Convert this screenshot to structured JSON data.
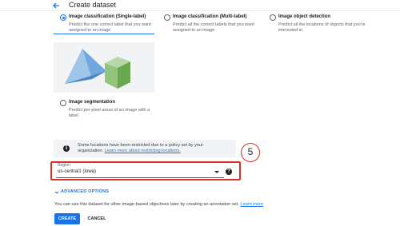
{
  "header": {
    "title": "Create dataset"
  },
  "options": [
    {
      "label": "Image classification (Single-label)",
      "desc": "Predict the one correct label that you want assigned to an image",
      "checked": true
    },
    {
      "label": "Image classification (Multi-label)",
      "desc": "Predict all the correct labels that you want assigned to an image",
      "checked": false
    },
    {
      "label": "Image object detection",
      "desc": "Predict all the locations of objects that you're interested in.",
      "checked": false
    },
    {
      "label": "Image segmentation",
      "desc": "Predict per-pixel areas of an image with a label.",
      "checked": false
    }
  ],
  "notice": {
    "text": "Some locations have been restricted due to a policy set by your organization.",
    "link": "Learn more about restricting locations."
  },
  "annotation_number": "5",
  "region": {
    "label": "Region",
    "value": "us-central1 (Iowa)"
  },
  "advanced_options": "ADVANCED OPTIONS",
  "footnote": {
    "text": "You can use this dataset for other image-based objectives later by creating an annotation set.",
    "link": "Learn more"
  },
  "buttons": {
    "create": "CREATE",
    "cancel": "CANCEL"
  },
  "colors": {
    "accent": "#1a73e8",
    "highlight": "#d93025",
    "pyramid": "#6fa8dc",
    "cube": "#93c47d"
  }
}
